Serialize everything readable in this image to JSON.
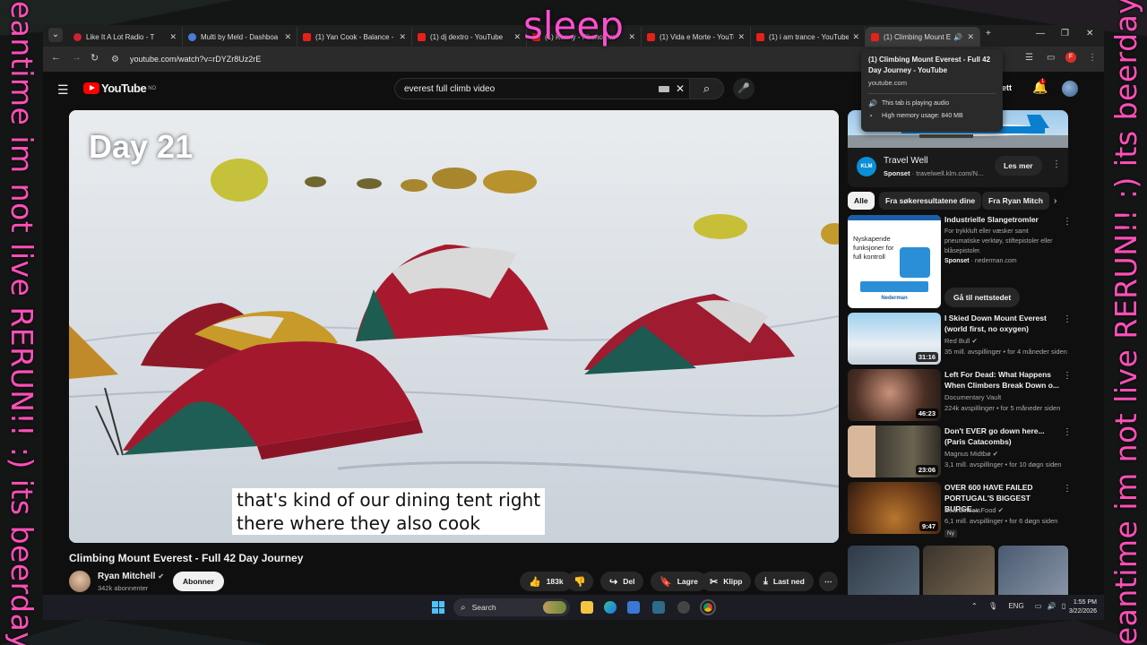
{
  "overlay": {
    "top_text": "sleep",
    "left_vertical": "meantime im not live RERUN!! :) its beerday!!",
    "right_vertical": "meantime im not live RERUN!! :) its beerday!!"
  },
  "browser": {
    "tabs": [
      {
        "title": "Like It A Lot Radio - T",
        "icon": "radio-icon"
      },
      {
        "title": "Multi by Meld - Dashboa",
        "icon": "meld-icon"
      },
      {
        "title": "(1) Yan Cook - Balance - Y",
        "icon": "youtube-icon"
      },
      {
        "title": "(1) dj dextro - YouTube",
        "icon": "youtube-icon"
      },
      {
        "title": "(1) Kenny - Phonomat",
        "icon": "youtube-icon"
      },
      {
        "title": "(1) Vida e Morte - YouTub",
        "icon": "youtube-icon"
      },
      {
        "title": "(1) i am trance - YouTube",
        "icon": "youtube-icon"
      },
      {
        "title": "(1) Climbing Mount E",
        "icon": "youtube-icon"
      }
    ],
    "new_tab": "+",
    "url": "youtube.com/watch?v=rDYZr8Uz2rE",
    "profile_initial": "F",
    "tooltip": {
      "title": "(1) Climbing Mount Everest - Full 42 Day Journey - YouTube",
      "domain": "youtube.com",
      "audio": "This tab is playing audio",
      "memory": "High memory usage: 840 MB"
    }
  },
  "youtube": {
    "logo_text": "YouTube",
    "logo_region": "NO",
    "search_value": "everest full climb video",
    "signin_partial": "ett",
    "bell_count": "1",
    "video": {
      "overlay_text": "Day 21",
      "caption_line1": "that's kind of our dining tent right",
      "caption_line2": "there where they also cook",
      "title": "Climbing Mount Everest - Full 42 Day Journey",
      "channel": "Ryan Mitchell",
      "subscribers": "342k abonnenter",
      "subscribe_label": "Abonner",
      "likes": "183k",
      "share": "Del",
      "save": "Lagre",
      "clip": "Klipp",
      "download": "Last ned"
    },
    "ad": {
      "title": "Travel Well",
      "sponsor_label": "Sponset",
      "domain": "travelwell.klm.com/N...",
      "button": "Les mer",
      "logo": "KLM"
    },
    "chips": [
      "Alle",
      "Fra søkeresultatene dine",
      "Fra Ryan Mitch"
    ],
    "ad2": {
      "title": "Industrielle Slangetromler",
      "description": "For trykkluft eller væsker samt pneumatiske verktøy, stiftepistoler eller blåsepistoler.",
      "sponsor_label": "Sponset",
      "domain": "nederman.com",
      "button": "Gå til nettstedet",
      "image_text": "Nyskapende funksjoner for full kontroll",
      "brand": "Nederman"
    },
    "related": [
      {
        "title": "I Skied Down Mount Everest (world first, no oxygen)",
        "channel": "Red Bull",
        "meta": "35 mill. avspillinger • for 4 måneder siden",
        "duration": "31:16"
      },
      {
        "title": "Left For Dead: What Happens When Climbers Break Down o...",
        "channel": "Documentary Vault",
        "meta": "224k avspillinger • for 5 måneder siden",
        "duration": "46:23"
      },
      {
        "title": "Don't EVER go down here... (Paris Catacombs)",
        "channel": "Magnus Midtbø",
        "meta": "3,1 mill. avspillinger • for 10 døgn siden",
        "duration": "23:06"
      },
      {
        "title": "OVER 600 HAVE FAILED PORTUGAL'S BIGGEST BURGE...",
        "channel": "BeardMeatsFood",
        "meta": "6,1 mill. avspillinger • for 6 døgn siden",
        "duration": "9:47",
        "badge": "Ny"
      }
    ]
  },
  "taskbar": {
    "search_label": "Search",
    "language": "ENG",
    "time": "1:55 PM",
    "date": "3/22/2026"
  }
}
